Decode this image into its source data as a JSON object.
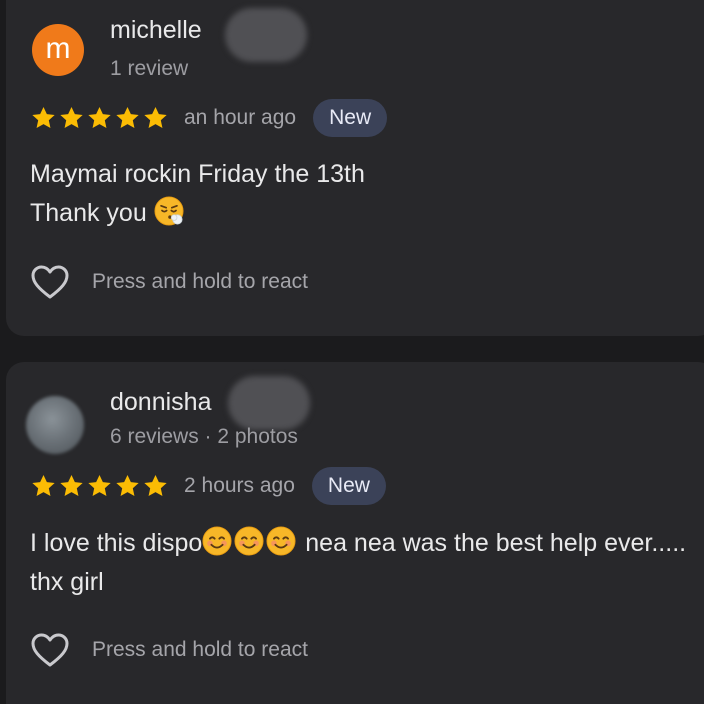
{
  "reviews": [
    {
      "avatar_letter": "m",
      "name": "michelle",
      "meta": "1 review",
      "stars": 5,
      "time": "an hour ago",
      "badge": "New",
      "text_line_1": "Maymai rockin Friday the 13th",
      "text_line_2": "Thank you",
      "emoji": "face-exhaling-emoji",
      "react_label": "Press and hold to react"
    },
    {
      "name": "donnisha",
      "meta": "6 reviews · 2 photos",
      "stars": 5,
      "time": "2 hours ago",
      "badge": "New",
      "text_part_1": "I love this dispo",
      "text_part_2": " nea nea was the best help ever..... thx girl",
      "emoji": "smiling-face-emoji",
      "react_label": "Press and hold to react"
    }
  ],
  "colors": {
    "background": "#1b1b1d",
    "card": "#28282b",
    "star": "#fbbc04",
    "badge": "#3b4258",
    "avatar_orange": "#f07a1a"
  }
}
